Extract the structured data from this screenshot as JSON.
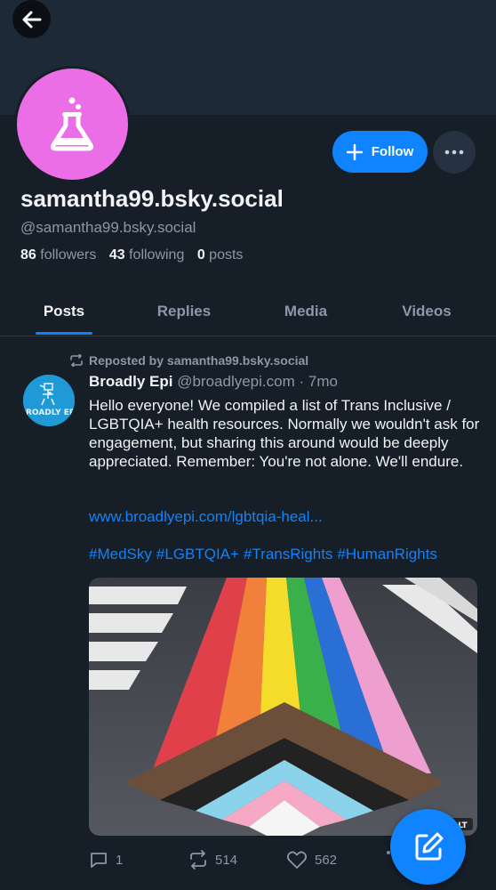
{
  "profile": {
    "display_name": "samantha99.bsky.social",
    "handle": "@samantha99.bsky.social",
    "followers_count": "86",
    "followers_label": "followers",
    "following_count": "43",
    "following_label": "following",
    "posts_count": "0",
    "posts_label": "posts",
    "avatar_color": "#ec6ee6",
    "avatar_icon": "flask-icon"
  },
  "header": {
    "back_icon": "arrow-left-icon",
    "follow_label": "Follow",
    "more_icon": "ellipsis-icon"
  },
  "tabs": [
    {
      "label": "Posts",
      "active": true
    },
    {
      "label": "Replies",
      "active": false
    },
    {
      "label": "Media",
      "active": false
    },
    {
      "label": "Videos",
      "active": false
    }
  ],
  "post": {
    "repost_label": "Reposted by samantha99.bsky.social",
    "author_name": "Broadly Epi",
    "author_handle": "@broadlyepi.com",
    "separator": " · ",
    "time": "7mo",
    "avatar_text": "BROADLY EPI",
    "text": "Hello everyone! We compiled a list of Trans Inclusive / LGBTQIA+ health resources. Normally we wouldn't ask for engagement, but sharing this around would be deeply appreciated. Remember: You're not alone. We'll endure.",
    "link": "www.broadlyepi.com/lgbtqia-heal...",
    "hashtags": [
      "#MedSky",
      "#LGBTQIA+",
      "#TransRights",
      "#HumanRights"
    ],
    "image_badge": "ALT",
    "replies": "1",
    "reposts": "514",
    "likes": "562"
  },
  "fab": {
    "icon": "compose-icon"
  },
  "colors": {
    "background": "#161e27",
    "banner": "#1e2937",
    "accent": "#1083fe",
    "muted_text": "#8b98a9"
  }
}
